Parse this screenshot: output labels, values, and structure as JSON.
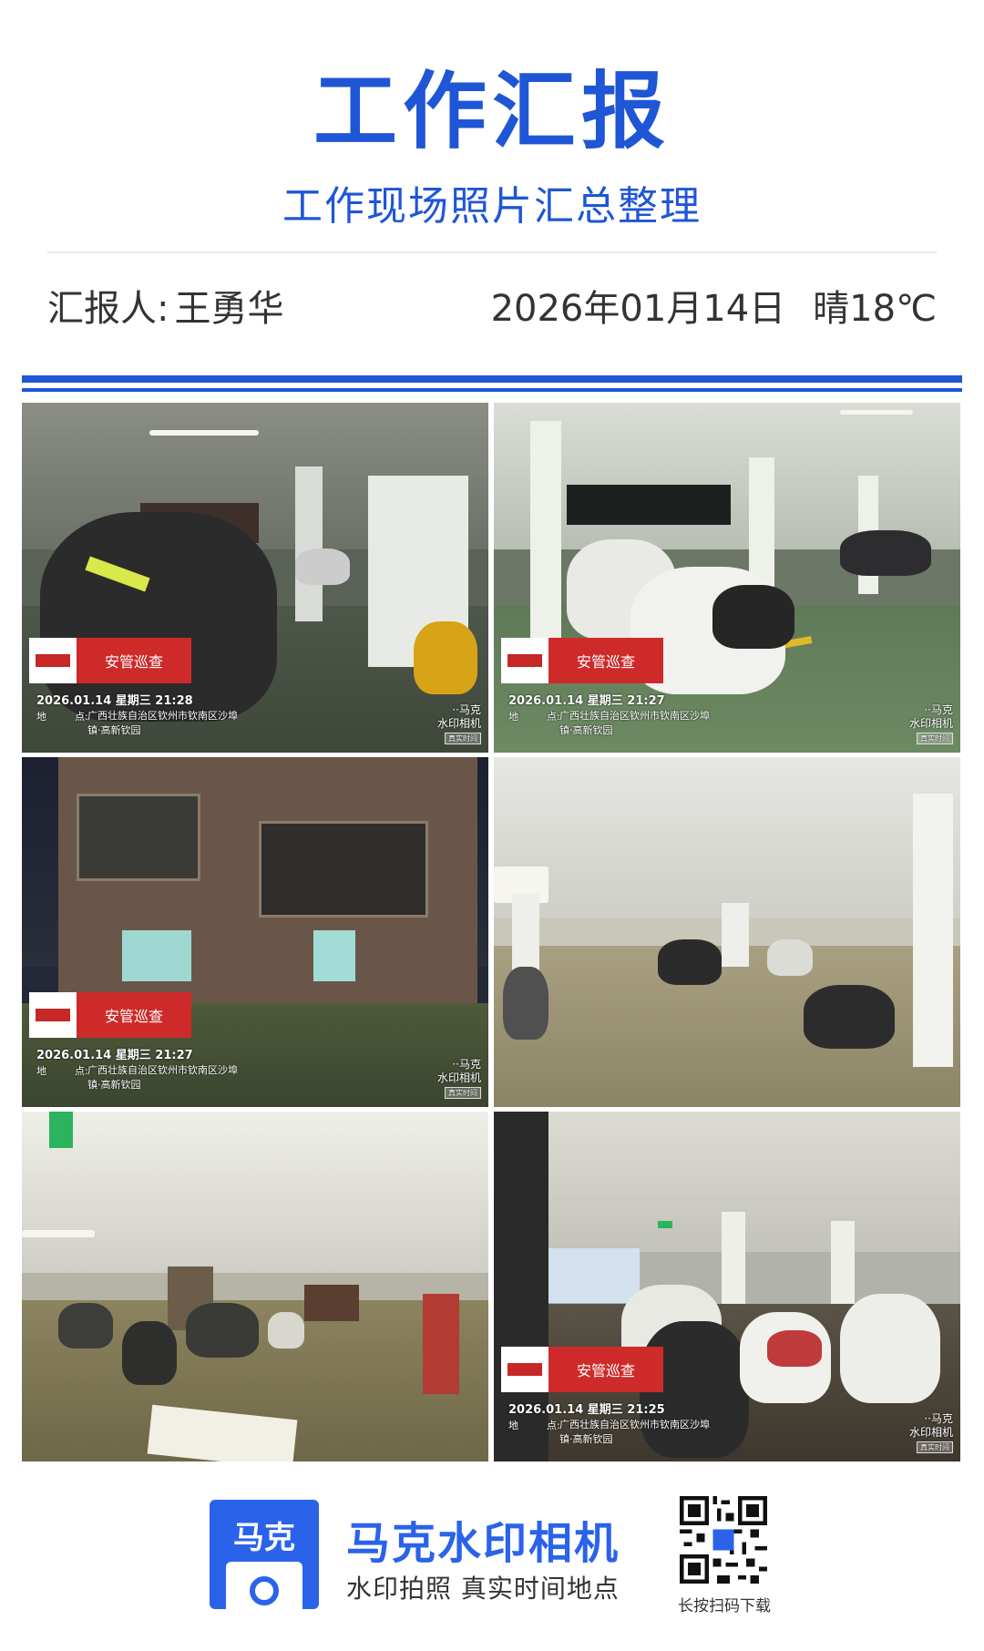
{
  "header": {
    "title": "工作汇报",
    "subtitle": "工作现场照片汇总整理",
    "reporter_label": "汇报人:",
    "reporter_name": "王勇华",
    "date": "2026年01月14日",
    "weather": "晴18℃"
  },
  "photos": [
    {
      "watermark_title": "安管巡查",
      "time": "2026.01.14 星期三 21:28",
      "place_label": "地",
      "place_colon": "点:",
      "place": "广西壮族自治区钦州市钦南区沙埠镇·高新钦园",
      "brand_line1": "··马克",
      "brand_line2": "水印相机",
      "verified": "真实时间"
    },
    {
      "watermark_title": "安管巡查",
      "time": "2026.01.14 星期三 21:27",
      "place_label": "地",
      "place_colon": "点:",
      "place": "广西壮族自治区钦州市钦南区沙埠镇·高新钦园",
      "brand_line1": "··马克",
      "brand_line2": "水印相机",
      "verified": "真实时间"
    },
    {
      "watermark_title": "安管巡查",
      "time": "2026.01.14 星期三 21:27",
      "place_label": "地",
      "place_colon": "点:",
      "place": "广西壮族自治区钦州市钦南区沙埠镇·高新钦园",
      "brand_line1": "··马克",
      "brand_line2": "水印相机",
      "verified": "真实时间"
    },
    {
      "watermark_title": "",
      "time": "",
      "place": ""
    },
    {
      "watermark_title": "",
      "time": "",
      "place": ""
    },
    {
      "watermark_title": "安管巡查",
      "time": "2026.01.14 星期三 21:25",
      "place_label": "地",
      "place_colon": "点:",
      "place": "广西壮族自治区钦州市钦南区沙埠镇·高新钦园",
      "brand_line1": "··马克",
      "brand_line2": "水印相机",
      "verified": "真实时间"
    }
  ],
  "footer": {
    "logo_text": "马克",
    "app_name": "马克水印相机",
    "slogan": "水印拍照 真实时间地点",
    "qr_label": "长按扫码下载"
  },
  "colors": {
    "accent": "#1f56d6",
    "watermark_red": "#cf2a2a"
  }
}
